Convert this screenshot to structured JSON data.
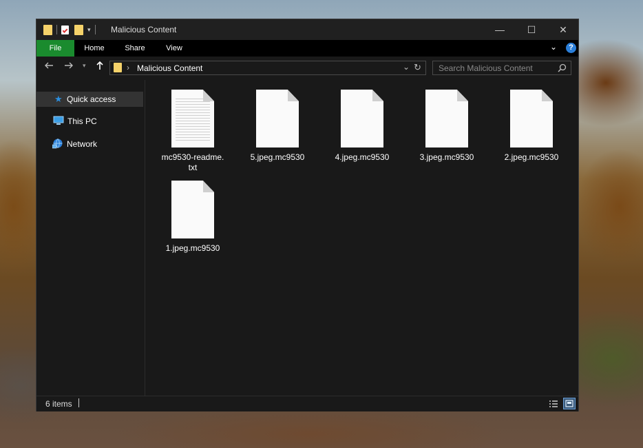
{
  "window": {
    "title": "Malicious Content",
    "controls": {
      "minimize": "—",
      "maximize": "☐",
      "close": "✕"
    }
  },
  "ribbon": {
    "tabs": [
      {
        "label": "File",
        "active": true,
        "color": "#1a8b2e"
      },
      {
        "label": "Home"
      },
      {
        "label": "Share"
      },
      {
        "label": "View"
      }
    ],
    "help_label": "?"
  },
  "navigation": {
    "back_icon": "arrow-left-icon",
    "forward_icon": "arrow-right-icon",
    "recent_icon": "chevron-down-icon",
    "up_icon": "arrow-up-icon",
    "breadcrumb_separator": "›",
    "path": "Malicious Content",
    "search_placeholder": "Search Malicious Content"
  },
  "sidebar": {
    "items": [
      {
        "label": "Quick access",
        "icon": "star-icon",
        "selected": true
      },
      {
        "label": "This PC",
        "icon": "computer-icon"
      },
      {
        "label": "Network",
        "icon": "network-icon"
      }
    ]
  },
  "files": [
    {
      "name": "mc9530-readme.txt",
      "line1": "mc9530-readme.",
      "line2": "txt",
      "type": "text"
    },
    {
      "name": "5.jpeg.mc9530",
      "type": "generic"
    },
    {
      "name": "4.jpeg.mc9530",
      "type": "generic"
    },
    {
      "name": "3.jpeg.mc9530",
      "type": "generic"
    },
    {
      "name": "2.jpeg.mc9530",
      "type": "generic"
    },
    {
      "name": "1.jpeg.mc9530",
      "type": "generic"
    }
  ],
  "status": {
    "item_count": "6 items",
    "view_modes": [
      "details-view-icon",
      "large-icons-view-icon"
    ],
    "active_view": "large-icons-view-icon"
  },
  "colors": {
    "window_bg": "#191919",
    "accent_file_tab": "#1a8b2e",
    "help_button": "#2b7fd9",
    "quick_access_star": "#2b8fe0"
  }
}
